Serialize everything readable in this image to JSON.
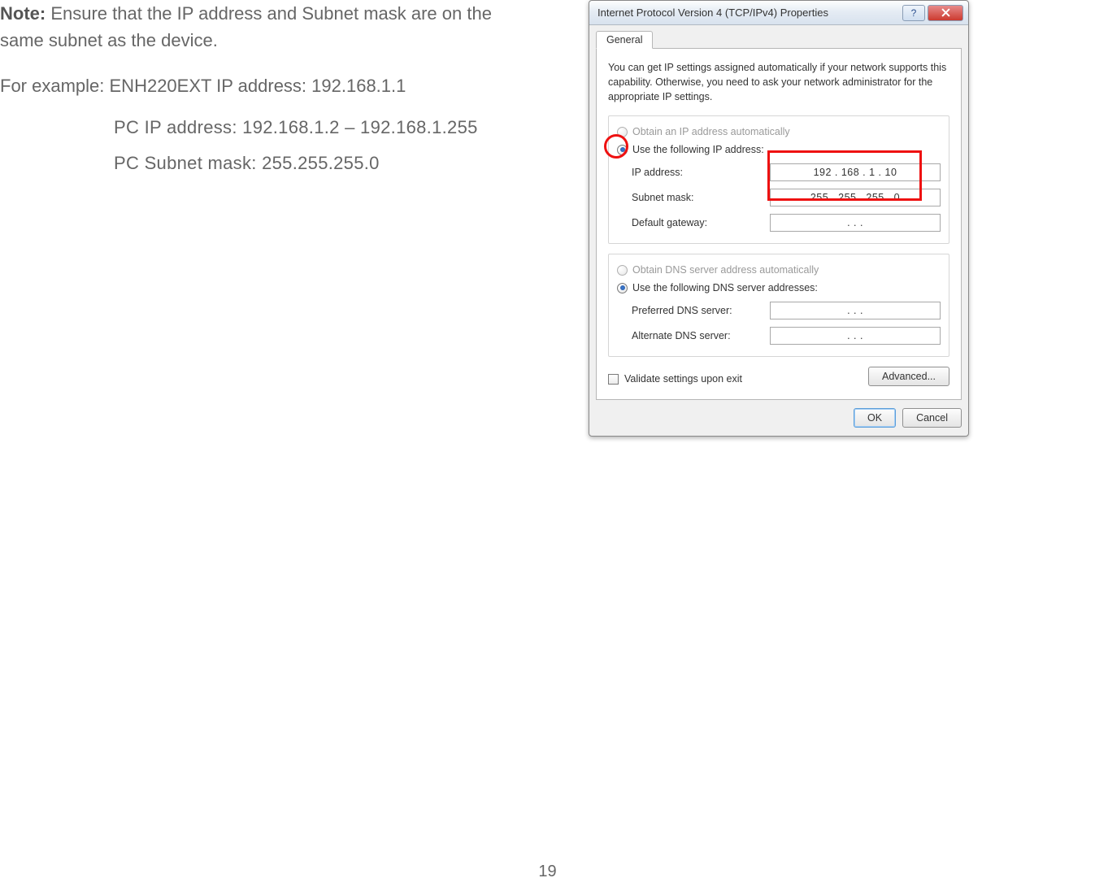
{
  "doc": {
    "note_prefix": "Note:",
    "note_text": " Ensure that the IP address and Subnet mask are on the same subnet as the device.",
    "example_prefix": "For example:",
    "example_line1": " ENH220EXT IP address: 192.168.1.1",
    "example_line2": "PC IP address: 192.168.1.2 – 192.168.1.255",
    "example_line3": "PC Subnet mask: 255.255.255.0",
    "page_number": "19"
  },
  "dialog": {
    "title": "Internet Protocol Version 4 (TCP/IPv4) Properties",
    "tab": "General",
    "description": "You can get IP settings assigned automatically if your network supports this capability. Otherwise, you need to ask your network administrator for the appropriate IP settings.",
    "ip_group": {
      "opt_auto": "Obtain an IP address automatically",
      "opt_manual": "Use the following IP address:",
      "label_ip": "IP address:",
      "label_subnet": "Subnet mask:",
      "label_gateway": "Default gateway:",
      "val_ip": "192 . 168 .   1   .  10",
      "val_subnet": "255 . 255 . 255 .   0",
      "val_gateway": ".       .       ."
    },
    "dns_group": {
      "opt_auto": "Obtain DNS server address automatically",
      "opt_manual": "Use the following DNS server addresses:",
      "label_pref": "Preferred DNS server:",
      "label_alt": "Alternate DNS server:",
      "val_pref": ".       .       .",
      "val_alt": ".       .       ."
    },
    "validate": "Validate settings upon exit",
    "advanced": "Advanced...",
    "ok": "OK",
    "cancel": "Cancel"
  }
}
